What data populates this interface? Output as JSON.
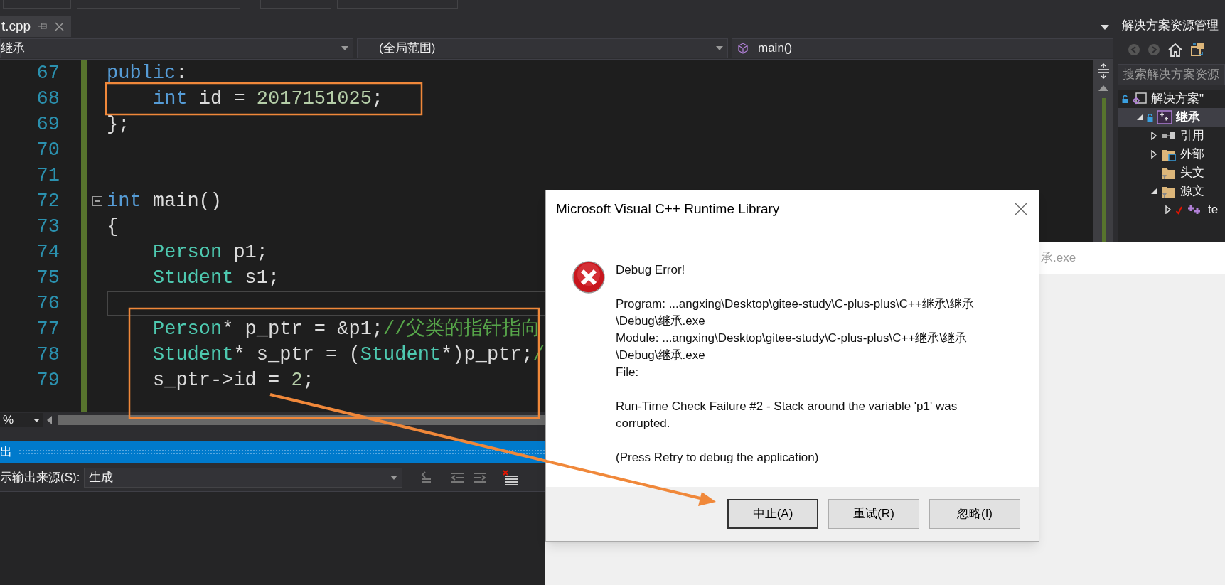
{
  "editor_tab": {
    "label": "t.cpp",
    "selected": true
  },
  "nav_bar": {
    "project": "继承",
    "scope": "(全局范围)",
    "member": "main()"
  },
  "code_lines": [
    {
      "number": "67",
      "current": false,
      "foldable": false,
      "tokens": [
        {
          "text": "public",
          "kind": "keyword"
        },
        {
          "text": ":",
          "kind": "plain"
        }
      ],
      "children": [
        {
          "number": "68",
          "current": false,
          "foldable": false,
          "tokens": [
            {
              "text": "int",
              "kind": "keyword"
            },
            {
              "text": " id = ",
              "kind": "plain"
            },
            {
              "text": "2017151025",
              "kind": "number"
            },
            {
              "text": ";",
              "kind": "plain"
            }
          ]
        }
      ]
    },
    {
      "number": "69",
      "current": false,
      "foldable": false,
      "tokens": [
        {
          "text": "};",
          "kind": "plain"
        }
      ]
    },
    {
      "number": "70",
      "current": false,
      "foldable": false
    },
    {
      "number": "71",
      "current": false,
      "foldable": false
    },
    {
      "number": "72",
      "current": false,
      "foldable": true,
      "tokens": [
        {
          "text": "int",
          "kind": "keyword"
        },
        {
          "text": " main()",
          "kind": "plain"
        }
      ]
    },
    {
      "number": "73",
      "current": false,
      "foldable": false,
      "tokens": [
        {
          "text": "{",
          "kind": "plain"
        }
      ],
      "children": [
        {
          "number": "74",
          "current": false,
          "foldable": false,
          "tokens": [
            {
              "text": "Person",
              "kind": "type"
            },
            {
              "text": " p1;",
              "kind": "plain"
            }
          ]
        },
        {
          "number": "75",
          "current": false,
          "foldable": false,
          "tokens": [
            {
              "text": "Student",
              "kind": "type"
            },
            {
              "text": " s1;",
              "kind": "plain"
            }
          ]
        },
        {
          "number": "76",
          "current": true,
          "foldable": false
        },
        {
          "number": "77",
          "current": false,
          "foldable": false,
          "tokens": [
            {
              "text": "Person",
              "kind": "type"
            },
            {
              "text": "* p_ptr = &p1;",
              "kind": "plain"
            },
            {
              "text": "//父类的指针指向",
              "kind": "comment"
            }
          ]
        },
        {
          "number": "78",
          "current": false,
          "foldable": false,
          "tokens": [
            {
              "text": "Student",
              "kind": "type"
            },
            {
              "text": "* s_ptr = (",
              "kind": "plain"
            },
            {
              "text": "Student",
              "kind": "type"
            },
            {
              "text": "*)p_ptr;",
              "kind": "plain"
            },
            {
              "text": "/",
              "kind": "comment"
            }
          ]
        },
        {
          "number": "79",
          "current": false,
          "foldable": false,
          "tokens": [
            {
              "text": "s_ptr->id = ",
              "kind": "plain"
            },
            {
              "text": "2",
              "kind": "number"
            },
            {
              "text": ";",
              "kind": "plain"
            }
          ]
        }
      ]
    }
  ],
  "zoom": "%",
  "output": {
    "title": "出",
    "source_label": "示输出来源(S):",
    "source": "生成"
  },
  "solution_explorer": {
    "title": "解决方案资源管理",
    "search": {
      "placeholder": "搜索解决方案资源"
    },
    "tree": [
      {
        "label": "解决方案\"",
        "kind": "solution",
        "selected": false,
        "children": [
          {
            "label": "继承",
            "kind": "project",
            "expanded": true,
            "selected": true,
            "children": [
              {
                "label": "引用",
                "kind": "references",
                "expanded": false,
                "selected": false
              },
              {
                "label": "外部",
                "kind": "external-folder",
                "expanded": false,
                "selected": false
              },
              {
                "label": "头文",
                "kind": "filter-folder",
                "selected": false
              },
              {
                "label": "源文",
                "kind": "filter-folder",
                "expanded": true,
                "selected": false,
                "children": [
                  {
                    "label": "te",
                    "kind": "cpp-file",
                    "expanded": false,
                    "selected": false
                  }
                ]
              }
            ]
          }
        ]
      }
    ]
  },
  "console_window": {
    "title": "承.exe"
  },
  "dialog": {
    "title": "Microsoft Visual C++ Runtime Library",
    "message": [
      [
        "Debug Error!"
      ],
      [
        "Program: ...angxing\\Desktop\\gitee-study\\C-plus-plus\\C++继承\\继承",
        "\\Debug\\继承.exe",
        "Module: ...angxing\\Desktop\\gitee-study\\C-plus-plus\\C++继承\\继承",
        "\\Debug\\继承.exe",
        "File:"
      ],
      [
        "Run-Time Check Failure #2 - Stack around the variable 'p1' was",
        "corrupted."
      ],
      [
        "(Press Retry to debug the application)"
      ]
    ],
    "buttons": [
      {
        "label": "中止(A)",
        "default": true
      },
      {
        "label": "重试(R)",
        "default": false
      },
      {
        "label": "忽略(I)",
        "default": false
      }
    ]
  }
}
